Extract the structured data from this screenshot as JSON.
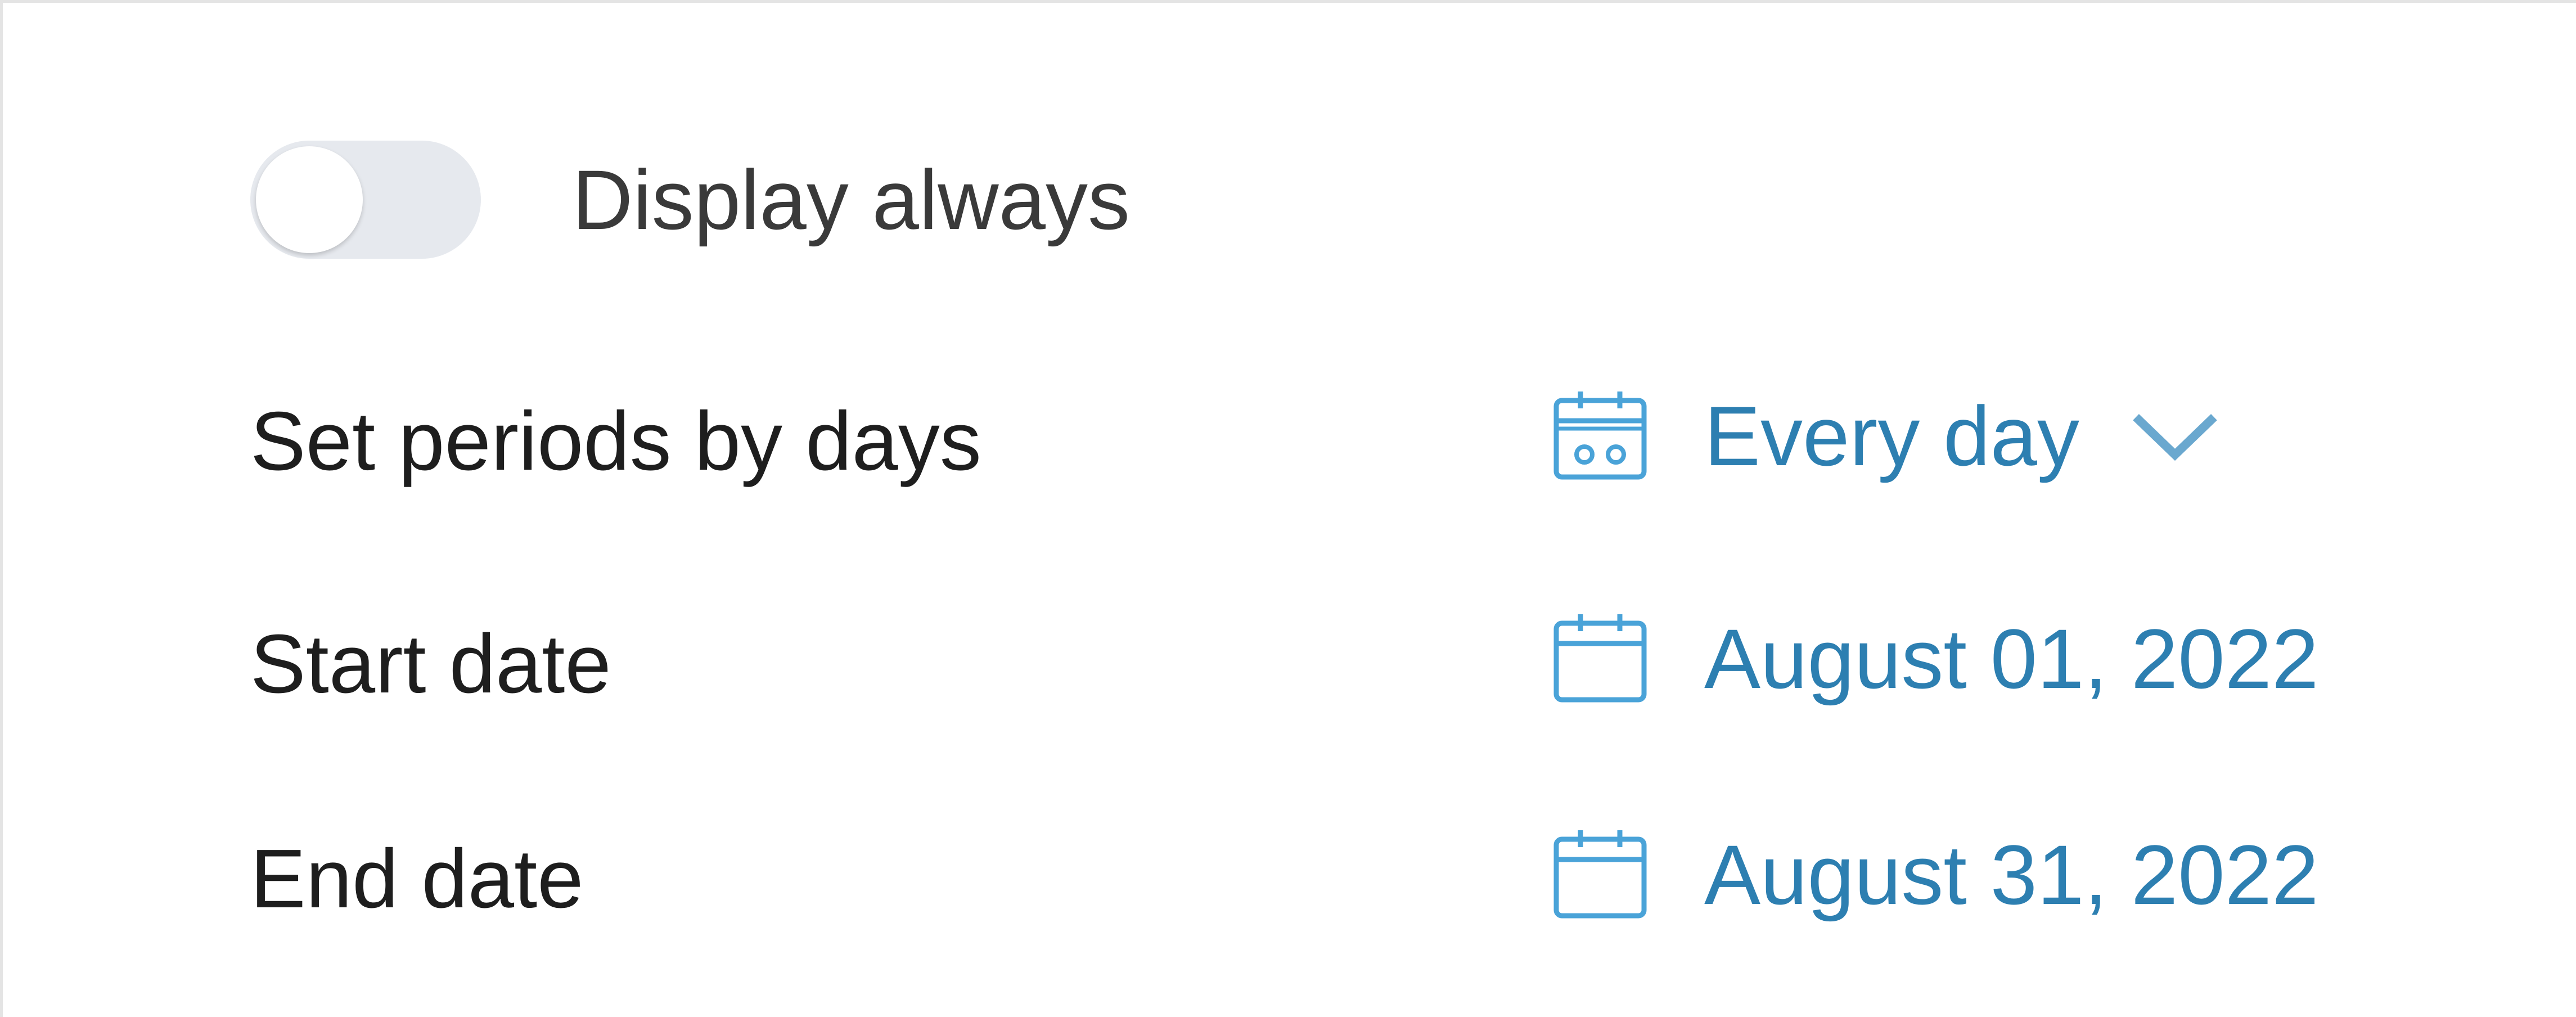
{
  "display_always": {
    "label": "Display always",
    "enabled": false
  },
  "rows": [
    {
      "label": "Set periods by days",
      "value": "Every day",
      "icon": "calendar-repeat-icon",
      "has_dropdown": true
    },
    {
      "label": "Start date",
      "value": "August 01, 2022",
      "icon": "calendar-icon",
      "has_dropdown": false
    },
    {
      "label": "End date",
      "value": "August 31, 2022",
      "icon": "calendar-icon",
      "has_dropdown": false
    }
  ],
  "colors": {
    "accent": "#2d7fb1",
    "icon": "#4aa3d8",
    "text": "#1e1e1e",
    "toggle_track": "#e6e9ee"
  }
}
